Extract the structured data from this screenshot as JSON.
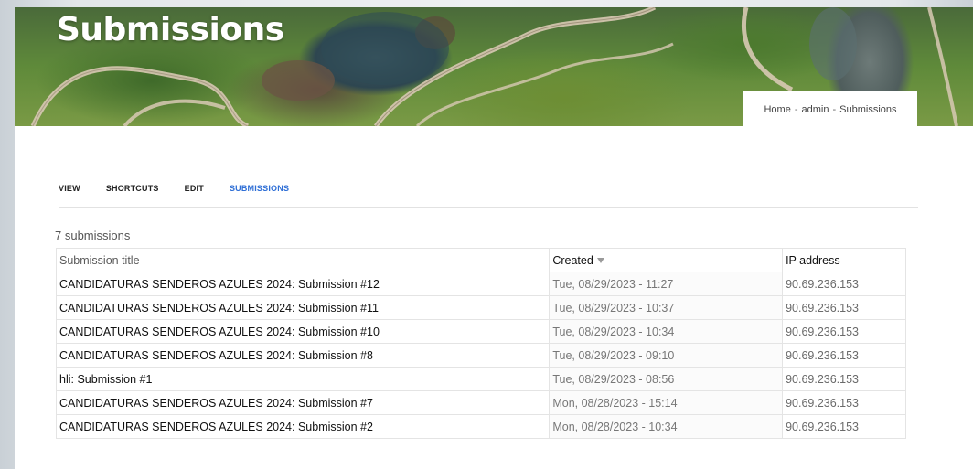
{
  "header": {
    "title": "Submissions",
    "breadcrumb": [
      "Home",
      "admin",
      "Submissions"
    ],
    "breadcrumb_separator": "-"
  },
  "tabs": [
    {
      "label": "VIEW",
      "active": false
    },
    {
      "label": "SHORTCUTS",
      "active": false
    },
    {
      "label": "EDIT",
      "active": false
    },
    {
      "label": "SUBMISSIONS",
      "active": true
    }
  ],
  "submissions_count": "7 submissions",
  "table": {
    "columns": [
      "Submission title",
      "Created",
      "IP address"
    ],
    "sort_column": "Created",
    "sort_icon": "sort-descending-icon",
    "rows": [
      {
        "title": "CANDIDATURAS SENDEROS AZULES 2024: Submission #12",
        "created": "Tue, 08/29/2023 - 11:27",
        "ip": "90.69.236.153"
      },
      {
        "title": "CANDIDATURAS SENDEROS AZULES 2024: Submission #11",
        "created": "Tue, 08/29/2023 - 10:37",
        "ip": "90.69.236.153"
      },
      {
        "title": "CANDIDATURAS SENDEROS AZULES 2024: Submission #10",
        "created": "Tue, 08/29/2023 - 10:34",
        "ip": "90.69.236.153"
      },
      {
        "title": "CANDIDATURAS SENDEROS AZULES 2024: Submission #8",
        "created": "Tue, 08/29/2023 - 09:10",
        "ip": "90.69.236.153"
      },
      {
        "title": "hli: Submission #1",
        "created": "Tue, 08/29/2023 - 08:56",
        "ip": "90.69.236.153"
      },
      {
        "title": "CANDIDATURAS SENDEROS AZULES 2024: Submission #7",
        "created": "Mon, 08/28/2023 - 15:14",
        "ip": "90.69.236.153"
      },
      {
        "title": "CANDIDATURAS SENDEROS AZULES 2024: Submission #2",
        "created": "Mon, 08/28/2023 - 10:34",
        "ip": "90.69.236.153"
      }
    ]
  },
  "colors": {
    "active_tab": "#2f6fd6",
    "hero_grass": "#5f8a3a",
    "hero_water": "#2e4650",
    "path": "#d8c9b4"
  }
}
